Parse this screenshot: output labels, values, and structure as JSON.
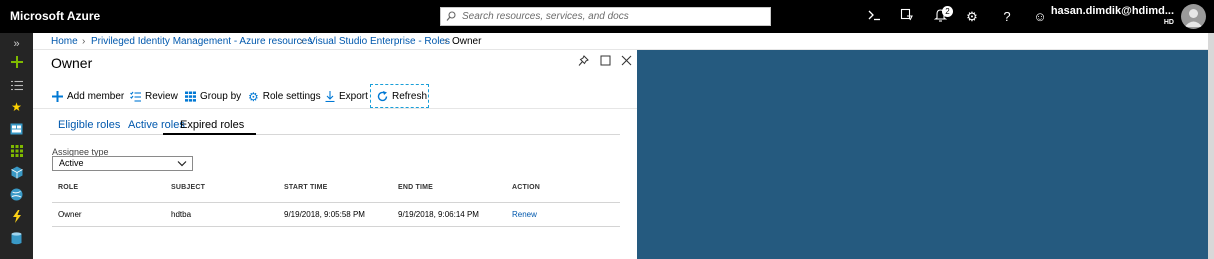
{
  "topbar": {
    "brand": "Microsoft Azure",
    "search_placeholder": "Search resources, services, and docs",
    "notifications_count": "2",
    "user_name": "hasan.dimdik@hdimd...",
    "user_org": "HD"
  },
  "breadcrumb": [
    "Home",
    "Privileged Identity Management - Azure resources",
    "Visual Studio Enterprise - Roles",
    "Owner"
  ],
  "blade": {
    "title": "Owner",
    "toolbar": {
      "add_member": "Add member",
      "review": "Review",
      "group_by": "Group by",
      "role_settings": "Role settings",
      "export": "Export",
      "refresh": "Refresh"
    },
    "tabs": [
      "Eligible roles",
      "Active roles",
      "Expired roles"
    ],
    "active_tab": "Expired roles",
    "assignee_type": {
      "label": "Assignee type",
      "value": "Active"
    },
    "table": {
      "columns": [
        "ROLE",
        "SUBJECT",
        "START TIME",
        "END TIME",
        "ACTION"
      ],
      "rows": [
        [
          "Owner",
          "hdtba",
          "9/19/2018, 9:05:58 PM",
          "9/19/2018, 9:06:14 PM",
          "Renew"
        ]
      ]
    }
  },
  "colors": {
    "topbar": "#000000",
    "leftnav": "#252525",
    "link": "#0058ad",
    "panel": "#255a7f",
    "refresh_focus": "#1a9fd8"
  },
  "icons": {
    "leftnav": [
      "expand-icon",
      "plus-icon",
      "list-icon",
      "star-icon",
      "dashboard-icon",
      "grid-icon",
      "cube-icon",
      "globe-icon",
      "lightning-icon",
      "sql-icon"
    ],
    "topbar": [
      "cloud-shell-icon",
      "directory-filter-icon",
      "bell-icon",
      "gear-icon",
      "help-icon",
      "smiley-icon"
    ]
  }
}
